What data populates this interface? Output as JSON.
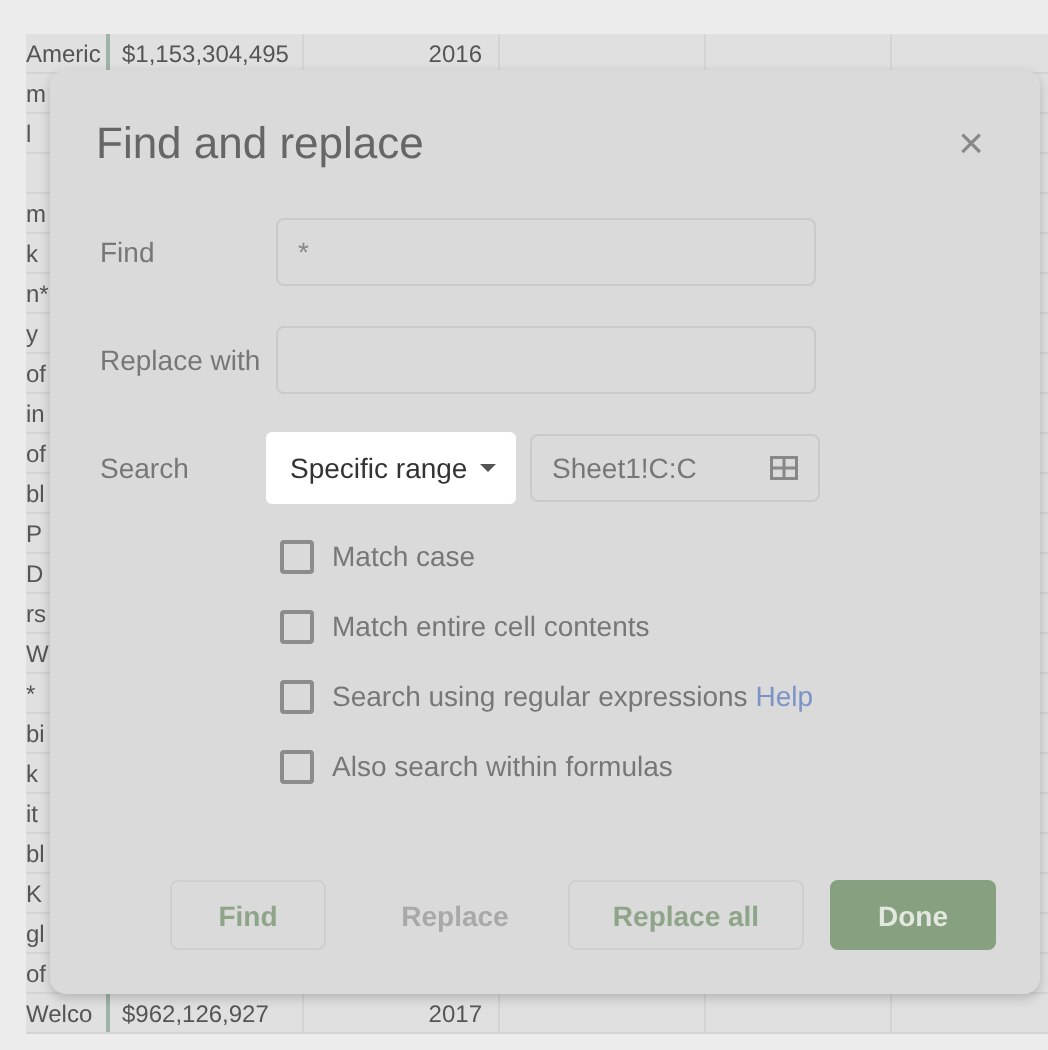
{
  "sheet": {
    "rows": [
      {
        "cells": [
          "Americ",
          "$1,153,304,495",
          "2016"
        ]
      },
      {
        "cells": [
          "m"
        ]
      },
      {
        "cells": [
          "l"
        ]
      },
      {
        "cells": []
      },
      {
        "cells": [
          "m"
        ]
      },
      {
        "cells": [
          "k"
        ]
      },
      {
        "cells": [
          "n*"
        ]
      },
      {
        "cells": [
          "y"
        ]
      },
      {
        "cells": [
          "of"
        ]
      },
      {
        "cells": [
          "in"
        ]
      },
      {
        "cells": [
          "of"
        ]
      },
      {
        "cells": [
          "bl"
        ]
      },
      {
        "cells": [
          "P"
        ]
      },
      {
        "cells": [
          "D"
        ]
      },
      {
        "cells": [
          "rs"
        ]
      },
      {
        "cells": [
          "W"
        ]
      },
      {
        "cells": [
          "*"
        ]
      },
      {
        "cells": [
          "bi"
        ]
      },
      {
        "cells": [
          "k"
        ]
      },
      {
        "cells": [
          "it"
        ]
      },
      {
        "cells": [
          "bl"
        ]
      },
      {
        "cells": [
          "K"
        ]
      },
      {
        "cells": [
          "gl"
        ]
      },
      {
        "cells": [
          "of"
        ]
      },
      {
        "cells": [
          "Welco",
          "$962,126,927",
          "2017"
        ]
      }
    ]
  },
  "dialog": {
    "title": "Find and replace",
    "close": "×",
    "find": {
      "label": "Find",
      "value": "*"
    },
    "replace": {
      "label": "Replace with"
    },
    "search": {
      "label": "Search",
      "scope": "Specific range",
      "range": "Sheet1!C:C"
    },
    "options": [
      {
        "label": "Match case",
        "checked": false
      },
      {
        "label": "Match entire cell contents",
        "checked": false
      },
      {
        "label": "Search using regular expressions",
        "link": "Help",
        "checked": false
      },
      {
        "label": "Also search within formulas",
        "checked": false
      }
    ],
    "buttons": [
      {
        "label": "Find",
        "kind": "outline",
        "disabled": false
      },
      {
        "label": "Replace",
        "kind": "outline",
        "disabled": true
      },
      {
        "label": "Replace all",
        "kind": "outline",
        "disabled": false
      },
      {
        "label": "Done",
        "kind": "primary",
        "disabled": false
      }
    ]
  }
}
